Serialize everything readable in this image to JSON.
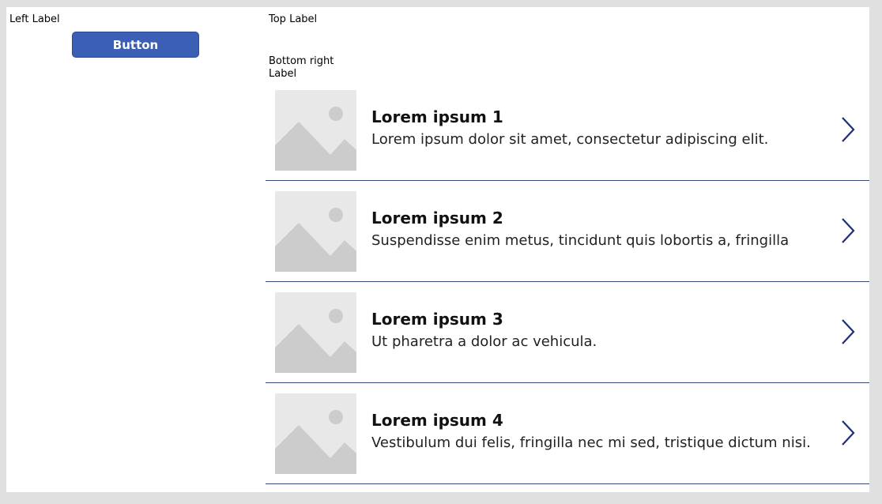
{
  "labels": {
    "left": "Left Label",
    "top": "Top Label",
    "bottom_right": "Bottom right Label"
  },
  "button": {
    "label": "Button"
  },
  "gallery": {
    "items": [
      {
        "title": "Lorem ipsum 1",
        "subtitle": "Lorem ipsum dolor sit amet, consectetur adipiscing elit.",
        "icon": "image-placeholder-icon",
        "nav_icon": "chevron-right-icon"
      },
      {
        "title": "Lorem ipsum 2",
        "subtitle": "Suspendisse enim metus, tincidunt quis lobortis a, fringilla",
        "icon": "image-placeholder-icon",
        "nav_icon": "chevron-right-icon"
      },
      {
        "title": "Lorem ipsum 3",
        "subtitle": "Ut pharetra a dolor ac vehicula.",
        "icon": "image-placeholder-icon",
        "nav_icon": "chevron-right-icon"
      },
      {
        "title": "Lorem ipsum 4",
        "subtitle": "Vestibulum dui felis, fringilla nec mi sed, tristique dictum nisi.",
        "icon": "image-placeholder-icon",
        "nav_icon": "chevron-right-icon"
      }
    ]
  },
  "colors": {
    "button_bg": "#3a5fb5",
    "divider": "#3a4a7a",
    "chevron": "#1f2f70",
    "placeholder_bg": "#e8e8e8",
    "placeholder_fg": "#cccccc"
  }
}
